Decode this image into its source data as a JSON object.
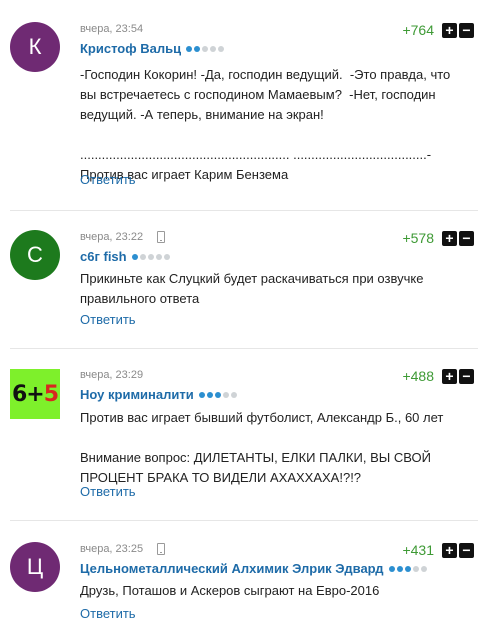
{
  "comments": [
    {
      "avatar": {
        "letter": "К",
        "color": "#6f2a73"
      },
      "time": "вчера, 23:54",
      "mobile": false,
      "author": "Кристоф Вальц",
      "level": [
        1,
        1,
        0,
        0,
        0
      ],
      "score": "+764",
      "text": "-Господин Кокорин! -Да, господин ведущий.  -Это правда, что вы встречаетесь с господином Мамаевым?  -Нет, господин ведущий. -А теперь, внимание на экран!\n\n.......................................................... .....................................- Против вас играет Карим Бензема",
      "reply": "Ответить"
    },
    {
      "avatar": {
        "letter": "С",
        "color": "#1d7a1d"
      },
      "time": "вчера, 23:22",
      "mobile": true,
      "author": "с6г fish",
      "level": [
        1,
        0,
        0,
        0,
        0
      ],
      "score": "+578",
      "text": "Прикиньте как Слуцкий будет раскачиваться при озвучке правильного ответа",
      "reply": "Ответить"
    },
    {
      "avatar": {
        "text_a": "6+",
        "text_b": "5",
        "bg": "#7ef02b"
      },
      "time": "вчера, 23:29",
      "mobile": false,
      "author": "Ноу криминалити",
      "level": [
        1,
        1,
        1,
        0,
        0
      ],
      "score": "+488",
      "text": "Против вас играет бывший футболист, Александр Б., 60 лет\n\nВнимание вопрос: ДИЛЕТАНТЫ, ЕЛКИ ПАЛКИ, ВЫ СВОЙ ПРОЦЕНТ БРАКА ТО ВИДЕЛИ АХАХХАХА!?!?",
      "reply": "Ответить"
    },
    {
      "avatar": {
        "letter": "Ц",
        "color": "#6f2a73"
      },
      "time": "вчера, 23:25",
      "mobile": true,
      "author": "Цельнометаллический Алхимик Элрик Эдвард",
      "level": [
        1,
        1,
        1,
        0,
        0
      ],
      "score": "+431",
      "text": "Друзь, Поташов и Аскеров сыграют на Евро-2016",
      "reply": "Ответить"
    }
  ],
  "vote": {
    "plus": "+",
    "minus": "−"
  },
  "icons": {
    "mobile": "phone-icon",
    "vote_up": "plus-icon",
    "vote_down": "minus-icon"
  }
}
